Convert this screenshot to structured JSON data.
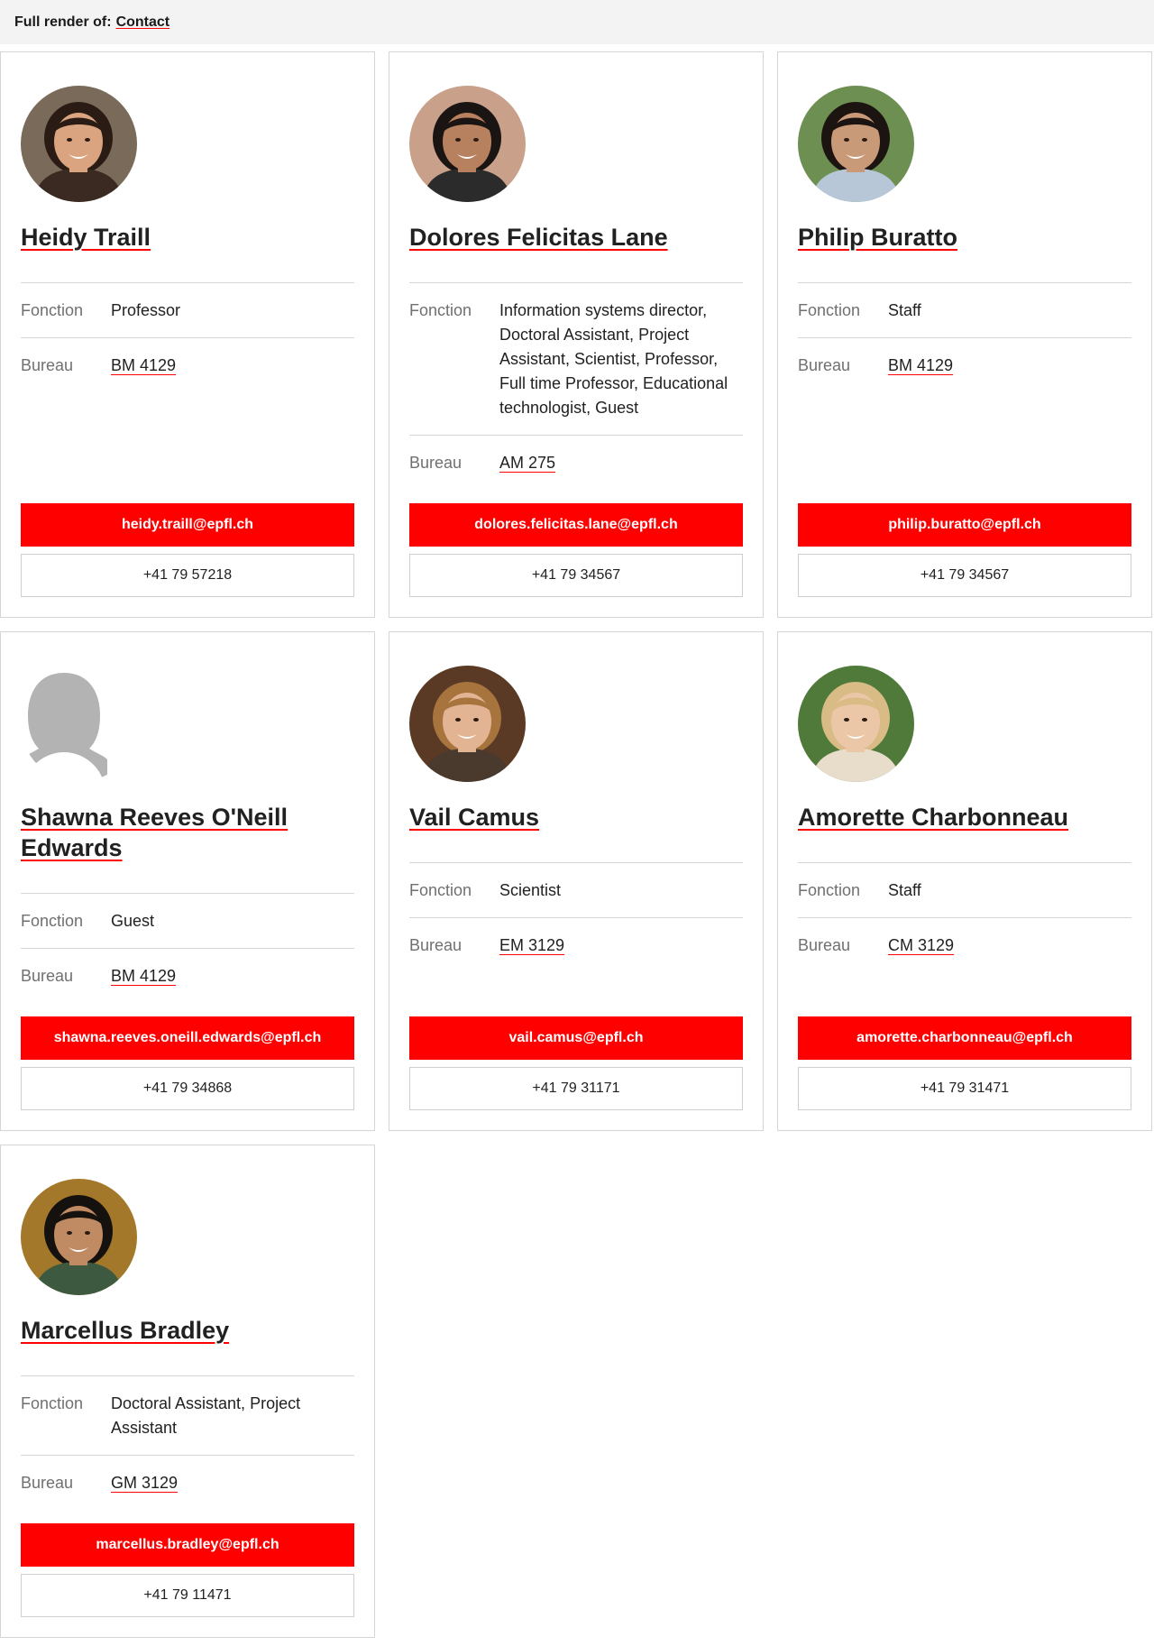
{
  "header": {
    "prefix": "Full render of:",
    "link": "Contact"
  },
  "labels": {
    "fonction": "Fonction",
    "bureau": "Bureau"
  },
  "cards": [
    {
      "name": "Heidy Traill",
      "fonction": "Professor",
      "bureau": "BM 4129",
      "email": "heidy.traill@epfl.ch",
      "phone": "+41 79 57218",
      "avatar": "photo",
      "skin": "#d9a47f",
      "hair": "#2a1c14",
      "shirt": "#3a2a22",
      "bg": "#7a6a5a"
    },
    {
      "name": "Dolores Felicitas Lane",
      "fonction": "Information systems director, Doctoral Assistant, Project Assistant, Scientist, Professor, Full time Professor, Educational technologist, Guest",
      "bureau": "AM 275",
      "email": "dolores.felicitas.lane@epfl.ch",
      "phone": "+41 79 34567",
      "avatar": "photo",
      "skin": "#b7805f",
      "hair": "#1a1412",
      "shirt": "#2b2b2b",
      "bg": "#c9a08a"
    },
    {
      "name": "Philip Buratto",
      "fonction": "Staff",
      "bureau": "BM 4129",
      "email": "philip.buratto@epfl.ch",
      "phone": "+41 79 34567",
      "avatar": "photo",
      "skin": "#c99a78",
      "hair": "#1c1410",
      "shirt": "#b8c7d8",
      "bg": "#6e8f52"
    },
    {
      "name": "Shawna Reeves O'Neill Edwards",
      "fonction": "Guest",
      "bureau": "BM 4129",
      "email": "shawna.reeves.oneill.edwards@epfl.ch",
      "phone": "+41 79 34868",
      "avatar": "placeholder"
    },
    {
      "name": "Vail Camus",
      "fonction": "Scientist",
      "bureau": "EM 3129",
      "email": "vail.camus@epfl.ch",
      "phone": "+41 79 31171",
      "avatar": "photo",
      "skin": "#e3b493",
      "hair": "#a8743e",
      "shirt": "#4a3a2e",
      "bg": "#5a3a24"
    },
    {
      "name": "Amorette Charbonneau",
      "fonction": "Staff",
      "bureau": "CM 3129",
      "email": "amorette.charbonneau@epfl.ch",
      "phone": "+41 79 31471",
      "avatar": "photo",
      "skin": "#ecc7a7",
      "hair": "#d9bb86",
      "shirt": "#e8dccb",
      "bg": "#4f7a3a"
    },
    {
      "name": "Marcellus Bradley",
      "fonction": "Doctoral Assistant, Project Assistant",
      "bureau": "GM 3129",
      "email": "marcellus.bradley@epfl.ch",
      "phone": "+41 79 11471",
      "avatar": "photo",
      "skin": "#c08a62",
      "hair": "#15110e",
      "shirt": "#3d5a40",
      "bg": "#a4782a"
    }
  ]
}
